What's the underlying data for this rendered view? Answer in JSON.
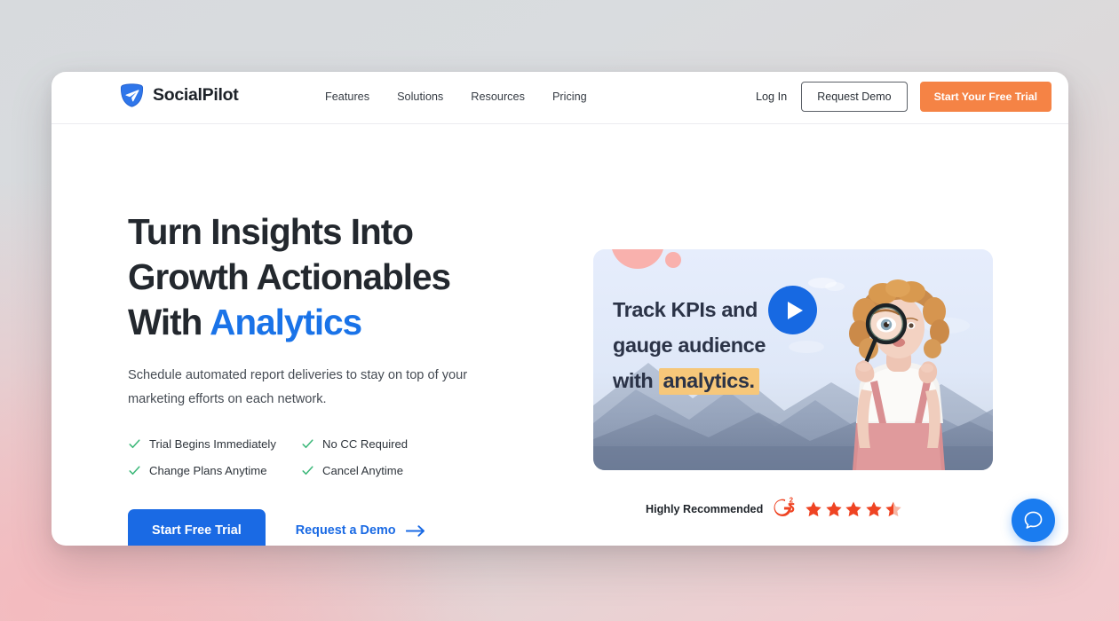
{
  "header": {
    "brand_name": "SocialPilot",
    "brand_icon": "paper-plane-icon",
    "nav": [
      {
        "label": "Features"
      },
      {
        "label": "Solutions"
      },
      {
        "label": "Resources"
      },
      {
        "label": "Pricing"
      }
    ],
    "login_label": "Log In",
    "request_demo_label": "Request Demo",
    "start_trial_label": "Start Your Free Trial"
  },
  "hero": {
    "title_line1": "Turn Insights Into",
    "title_line2": "Growth Actionables",
    "title_line3_prefix": "With ",
    "title_accent": "Analytics",
    "subtitle": "Schedule automated report deliveries to stay on top of your marketing efforts on each network.",
    "benefits": [
      {
        "label": "Trial Begins Immediately"
      },
      {
        "label": "No CC Required"
      },
      {
        "label": "Change Plans Anytime"
      },
      {
        "label": "Cancel Anytime"
      }
    ],
    "start_trial_label": "Start Free Trial",
    "request_demo_label": "Request a Demo"
  },
  "video": {
    "caption_line1": "Track KPIs and",
    "caption_line2": "gauge audience",
    "caption_line3_prefix": "with ",
    "caption_highlight": "analytics.",
    "play_icon": "play-icon"
  },
  "rating": {
    "label": "Highly Recommended",
    "badge": "G2",
    "badge_superscript": "2",
    "stars_total": 5,
    "stars_filled": 4,
    "stars_half": 1,
    "score": 4.5
  },
  "chat": {
    "icon": "chat-bubble-icon"
  },
  "colors": {
    "brand_blue": "#1a6ae4",
    "accent_blue": "#1a73e8",
    "cta_orange": "#f58345",
    "check_green": "#3db87a",
    "star_red": "#ef4423",
    "highlight_yellow": "#f6c77a",
    "chat_blue": "#1a7cf0",
    "text_dark": "#23282e"
  }
}
